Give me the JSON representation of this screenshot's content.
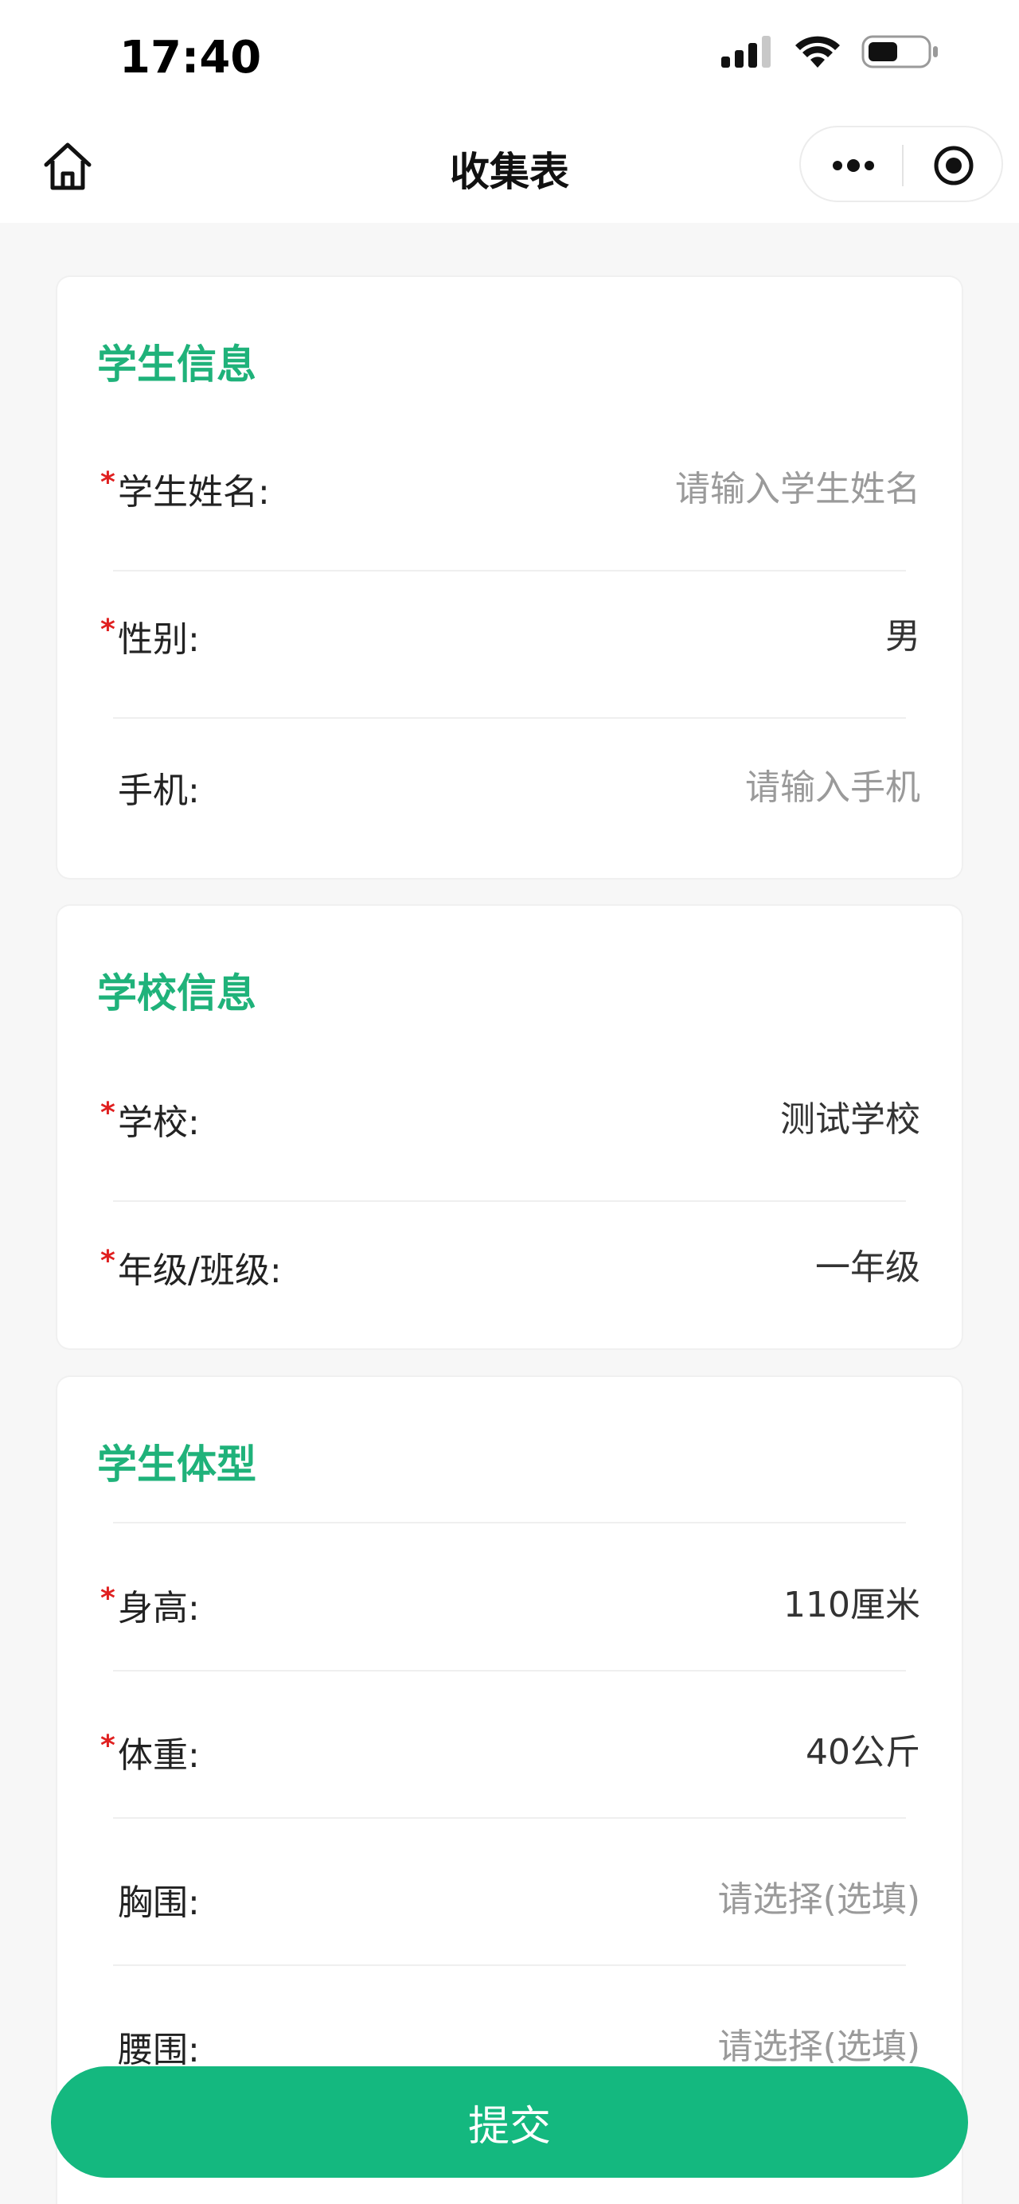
{
  "status_bar": {
    "time": "17:40",
    "icons": [
      "cellular-signal-icon",
      "wifi-icon",
      "battery-icon"
    ]
  },
  "nav": {
    "title": "收集表",
    "home_icon": "home-icon",
    "menu_icon": "more-dots-icon",
    "close_icon": "target-circle-icon"
  },
  "sections": {
    "student": {
      "title": "学生信息",
      "fields": [
        {
          "label": "学生姓名:",
          "required": "*",
          "value": "请输入学生姓名",
          "is_placeholder": true
        },
        {
          "label": "性别:",
          "required": "*",
          "value": "男",
          "is_placeholder": false
        },
        {
          "label": "手机:",
          "required": "",
          "value": "请输入手机",
          "is_placeholder": true
        }
      ]
    },
    "school": {
      "title": "学校信息",
      "fields": [
        {
          "label": "学校:",
          "required": "*",
          "value": "测试学校",
          "is_placeholder": false
        },
        {
          "label": "年级/班级:",
          "required": "*",
          "value": "一年级",
          "is_placeholder": false
        }
      ]
    },
    "body": {
      "title": "学生体型",
      "fields": [
        {
          "label": "身高:",
          "required": "*",
          "value": "110厘米",
          "is_placeholder": false
        },
        {
          "label": "体重:",
          "required": "*",
          "value": "40公斤",
          "is_placeholder": false
        },
        {
          "label": "胸围:",
          "required": "",
          "value": "请选择(选填)",
          "is_placeholder": true
        },
        {
          "label": "腰围:",
          "required": "",
          "value": "请选择(选填)",
          "is_placeholder": true
        }
      ]
    }
  },
  "submit": {
    "label": "提交"
  },
  "colors": {
    "accent": "#14b87f",
    "section_title": "#1fb27a",
    "required": "#e02020"
  }
}
